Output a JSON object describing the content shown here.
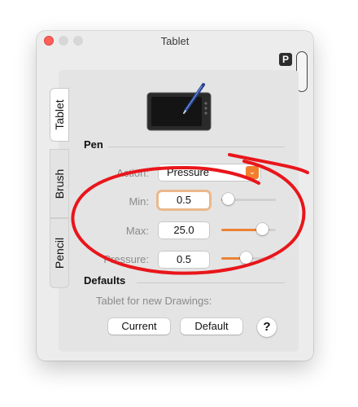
{
  "window": {
    "title": "Tablet"
  },
  "tabs": [
    {
      "label": "Tablet",
      "active": true
    },
    {
      "label": "Brush",
      "active": false
    },
    {
      "label": "Pencil",
      "active": false
    }
  ],
  "badge": {
    "label": "P"
  },
  "pen": {
    "section_title": "Pen",
    "action": {
      "label": "Action:",
      "value": "Pressure"
    },
    "min": {
      "label": "Min:",
      "value": "0.5",
      "slider_level": 0.12
    },
    "max": {
      "label": "Max:",
      "value": "25.0",
      "slider_level": 0.75
    },
    "pressure": {
      "label": "Pressure:",
      "value": "0.5",
      "slider_level": 0.45
    }
  },
  "defaults": {
    "section_title": "Defaults",
    "subtitle": "Tablet for new Drawings:",
    "current_button": "Current",
    "default_button": "Default",
    "help_button": "?"
  },
  "colors": {
    "accent": "#ec8234",
    "annotation_red": "#e8161b",
    "close": "#fe5f57"
  }
}
